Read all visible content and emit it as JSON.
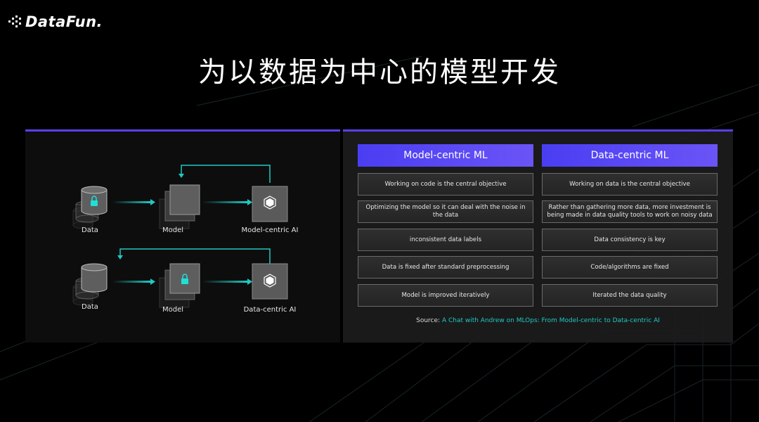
{
  "logo": {
    "text": "DataFun."
  },
  "title": "为以数据为中心的模型开发",
  "diagram": {
    "model_centric": {
      "nodes": [
        "Data",
        "Model",
        "Model-centric AI"
      ],
      "locked_node": "Data",
      "center_icon": "hexagon-gear-icon"
    },
    "data_centric": {
      "nodes": [
        "Data",
        "Model",
        "Data-centric AI"
      ],
      "locked_node": "Model",
      "center_icon": "hexagon-gear-icon"
    }
  },
  "comparison": {
    "headers": [
      "Model-centric ML",
      "Data-centric ML"
    ],
    "rows": [
      [
        "Working on code is the central objective",
        "Working on data is the central objective"
      ],
      [
        "Optimizing the model so it can deal with the noise in the data",
        "Rather than gathering more data, more investment is being made in data quality tools to work on noisy data"
      ],
      [
        "inconsistent data labels",
        "Data consistency is key"
      ],
      [
        "Data is fixed after standard preprocessing",
        "Code/algorithms are fixed"
      ],
      [
        "Model is improved iteratively",
        "Iterated the data quality"
      ]
    ],
    "source_label": "Source:",
    "source_link": "A Chat with Andrew on MLOps: From Model-centric to Data-centric AI"
  },
  "colors": {
    "accent_purple": "#5a3ff0",
    "accent_teal": "#1fc9c3",
    "background": "#000000"
  }
}
